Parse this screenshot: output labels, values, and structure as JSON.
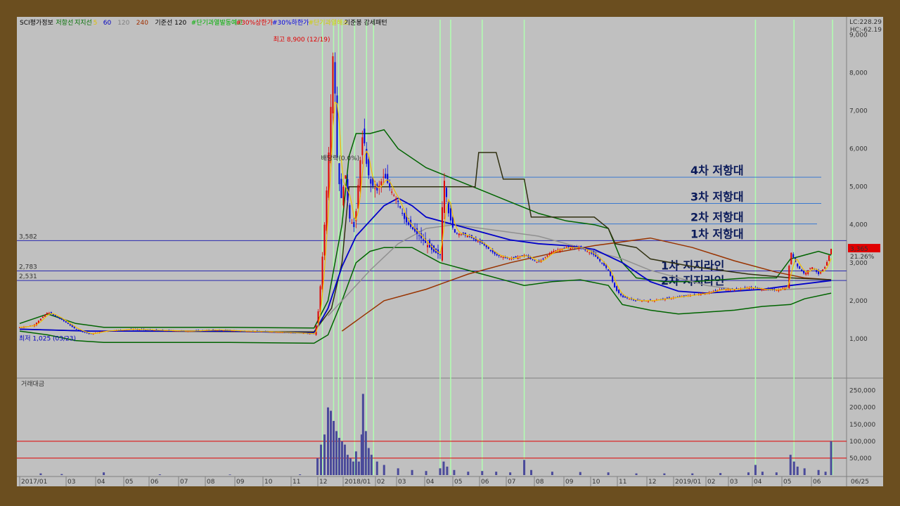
{
  "legend": [
    {
      "text": "SCI평가정보",
      "color": "#000000"
    },
    {
      "text": "저항선",
      "color": "#007000"
    },
    {
      "text": "지지선",
      "color": "#007000"
    },
    {
      "text": "5",
      "color": "#e0c000"
    },
    {
      "text": "60",
      "color": "#0000c0"
    },
    {
      "text": "120",
      "color": "#808080"
    },
    {
      "text": "240",
      "color": "#a03000"
    },
    {
      "text": "기준선 120",
      "color": "#000000"
    },
    {
      "text": "#단기과열발동예고",
      "color": "#00b000"
    },
    {
      "text": "#30%상한가",
      "color": "#e00000"
    },
    {
      "text": "#30%하한가",
      "color": "#0000e0"
    },
    {
      "text": "#단기과열해소",
      "color": "#d0d000"
    },
    {
      "text": "기준봉 강세패턴",
      "color": "#000000"
    }
  ],
  "lc_label": "LC:228.29",
  "hc_label": "HC:-62.19",
  "volume_title": "거래대금",
  "date_readout": "06/25",
  "annotations": {
    "high": "최고 8,900 (12/19)",
    "low": "최저 1,025 (03/23)",
    "badge": "배당락(0.0%)",
    "price_box": "3,365",
    "pct_box": "21.26%"
  },
  "colors": {
    "up": "#e00000",
    "down": "#0000e0",
    "band": "#006400",
    "ma5": "#f0c000",
    "ma60": "#0000c8",
    "ma120": "#909090",
    "ma240": "#993300",
    "base": "#303010",
    "vline": "#b0ffb0",
    "hline": "#2a2ab0",
    "resist": "#3a7ad0"
  },
  "chart_data": [
    {
      "type": "line",
      "title": "",
      "xlabel": "",
      "ylabel": "",
      "ylim": [
        0,
        9100
      ],
      "x_ticks": [
        "2017/01",
        "03",
        "04",
        "05",
        "06",
        "07",
        "08",
        "09",
        "10",
        "11",
        "12",
        "2018/01",
        "02",
        "03",
        "04",
        "05",
        "06",
        "07",
        "08",
        "09",
        "10",
        "11",
        "12",
        "2019/01",
        "02",
        "03",
        "04",
        "05",
        "06"
      ],
      "y_ticks": [
        "1,000",
        "2,000",
        "3,000",
        "4,000",
        "5,000",
        "6,000",
        "7,000",
        "8,000",
        "9,000"
      ],
      "series": [],
      "levels": [
        {
          "name": "4차 저항대",
          "value": 5250
        },
        {
          "name": "3차 저항대",
          "value": 4560
        },
        {
          "name": "2차 저항대",
          "value": 4020
        },
        {
          "name": "1차 저항대",
          "value": 3582
        },
        {
          "name": "1차 지지라인",
          "value": 2783
        },
        {
          "name": "2차 지지라인",
          "value": 2531
        }
      ],
      "level_labels": [
        "3,582",
        "2,783",
        "2,531"
      ],
      "current_price": 3365,
      "price_path": [
        [
          0,
          1300
        ],
        [
          20,
          1350
        ],
        [
          40,
          1700
        ],
        [
          60,
          1500
        ],
        [
          80,
          1250
        ],
        [
          100,
          1120
        ],
        [
          120,
          1200
        ],
        [
          160,
          1250
        ],
        [
          200,
          1220
        ],
        [
          240,
          1200
        ],
        [
          280,
          1230
        ],
        [
          320,
          1200
        ],
        [
          360,
          1180
        ],
        [
          400,
          1150
        ],
        [
          420,
          1130
        ],
        [
          425,
          1500
        ],
        [
          430,
          2600
        ],
        [
          435,
          4000
        ],
        [
          440,
          5500
        ],
        [
          445,
          7500
        ],
        [
          448,
          8900
        ],
        [
          452,
          6000
        ],
        [
          458,
          4600
        ],
        [
          465,
          5300
        ],
        [
          470,
          4200
        ],
        [
          478,
          3900
        ],
        [
          485,
          5500
        ],
        [
          490,
          6500
        ],
        [
          495,
          5600
        ],
        [
          500,
          5100
        ],
        [
          510,
          4900
        ],
        [
          520,
          5300
        ],
        [
          530,
          4900
        ],
        [
          540,
          4600
        ],
        [
          550,
          4100
        ],
        [
          570,
          3700
        ],
        [
          590,
          3300
        ],
        [
          600,
          3200
        ],
        [
          605,
          5300
        ],
        [
          612,
          4300
        ],
        [
          620,
          3800
        ],
        [
          640,
          3700
        ],
        [
          660,
          3500
        ],
        [
          680,
          3200
        ],
        [
          700,
          3100
        ],
        [
          720,
          3200
        ],
        [
          740,
          3000
        ],
        [
          760,
          3300
        ],
        [
          780,
          3400
        ],
        [
          800,
          3400
        ],
        [
          820,
          3200
        ],
        [
          840,
          2800
        ],
        [
          850,
          2300
        ],
        [
          860,
          2100
        ],
        [
          880,
          2000
        ],
        [
          900,
          2000
        ],
        [
          920,
          2050
        ],
        [
          940,
          2100
        ],
        [
          960,
          2150
        ],
        [
          980,
          2200
        ],
        [
          1000,
          2300
        ],
        [
          1020,
          2300
        ],
        [
          1040,
          2350
        ],
        [
          1060,
          2300
        ],
        [
          1080,
          2280
        ],
        [
          1095,
          2350
        ],
        [
          1100,
          3300
        ],
        [
          1105,
          3100
        ],
        [
          1110,
          2900
        ],
        [
          1120,
          2700
        ],
        [
          1130,
          2900
        ],
        [
          1140,
          2700
        ],
        [
          1150,
          2900
        ],
        [
          1158,
          3365
        ]
      ],
      "ma60_path": [
        [
          0,
          1250
        ],
        [
          100,
          1200
        ],
        [
          200,
          1200
        ],
        [
          300,
          1200
        ],
        [
          420,
          1150
        ],
        [
          440,
          1800
        ],
        [
          460,
          2900
        ],
        [
          480,
          3700
        ],
        [
          500,
          4100
        ],
        [
          520,
          4500
        ],
        [
          540,
          4700
        ],
        [
          560,
          4500
        ],
        [
          580,
          4200
        ],
        [
          620,
          4000
        ],
        [
          660,
          3800
        ],
        [
          700,
          3600
        ],
        [
          740,
          3500
        ],
        [
          780,
          3450
        ],
        [
          820,
          3350
        ],
        [
          860,
          3000
        ],
        [
          900,
          2500
        ],
        [
          940,
          2250
        ],
        [
          980,
          2200
        ],
        [
          1020,
          2250
        ],
        [
          1060,
          2300
        ],
        [
          1100,
          2400
        ],
        [
          1158,
          2530
        ]
      ],
      "ma120_path": [
        [
          440,
          1600
        ],
        [
          460,
          2000
        ],
        [
          500,
          2800
        ],
        [
          540,
          3500
        ],
        [
          580,
          3900
        ],
        [
          620,
          4000
        ],
        [
          660,
          3900
        ],
        [
          700,
          3800
        ],
        [
          740,
          3700
        ],
        [
          780,
          3500
        ],
        [
          820,
          3300
        ],
        [
          860,
          3100
        ],
        [
          900,
          2800
        ],
        [
          940,
          2600
        ],
        [
          980,
          2400
        ],
        [
          1020,
          2300
        ],
        [
          1060,
          2280
        ],
        [
          1100,
          2300
        ],
        [
          1158,
          2360
        ]
      ],
      "ma240_path": [
        [
          460,
          1200
        ],
        [
          520,
          2000
        ],
        [
          580,
          2300
        ],
        [
          640,
          2700
        ],
        [
          700,
          3000
        ],
        [
          760,
          3250
        ],
        [
          820,
          3450
        ],
        [
          880,
          3600
        ],
        [
          900,
          3650
        ],
        [
          960,
          3400
        ],
        [
          1020,
          3050
        ],
        [
          1080,
          2750
        ],
        [
          1120,
          2600
        ],
        [
          1158,
          2550
        ]
      ],
      "upper_band": [
        [
          0,
          1400
        ],
        [
          40,
          1650
        ],
        [
          80,
          1400
        ],
        [
          120,
          1300
        ],
        [
          200,
          1300
        ],
        [
          300,
          1300
        ],
        [
          420,
          1280
        ],
        [
          440,
          2000
        ],
        [
          460,
          4000
        ],
        [
          470,
          5800
        ],
        [
          480,
          6400
        ],
        [
          500,
          6400
        ],
        [
          520,
          6500
        ],
        [
          540,
          6000
        ],
        [
          580,
          5500
        ],
        [
          620,
          5200
        ],
        [
          660,
          4900
        ],
        [
          700,
          4600
        ],
        [
          740,
          4300
        ],
        [
          780,
          4100
        ],
        [
          820,
          4000
        ],
        [
          840,
          3900
        ],
        [
          860,
          3000
        ],
        [
          880,
          2600
        ],
        [
          920,
          2500
        ],
        [
          960,
          2500
        ],
        [
          1000,
          2550
        ],
        [
          1040,
          2600
        ],
        [
          1080,
          2600
        ],
        [
          1100,
          3100
        ],
        [
          1140,
          3300
        ],
        [
          1158,
          3200
        ]
      ],
      "lower_band": [
        [
          0,
          1200
        ],
        [
          40,
          1100
        ],
        [
          80,
          950
        ],
        [
          120,
          900
        ],
        [
          200,
          900
        ],
        [
          300,
          900
        ],
        [
          420,
          880
        ],
        [
          440,
          1100
        ],
        [
          460,
          2000
        ],
        [
          480,
          3000
        ],
        [
          500,
          3300
        ],
        [
          520,
          3400
        ],
        [
          560,
          3400
        ],
        [
          600,
          3000
        ],
        [
          620,
          2900
        ],
        [
          660,
          2700
        ],
        [
          700,
          2500
        ],
        [
          720,
          2400
        ],
        [
          760,
          2500
        ],
        [
          800,
          2550
        ],
        [
          840,
          2400
        ],
        [
          860,
          1900
        ],
        [
          900,
          1750
        ],
        [
          940,
          1650
        ],
        [
          980,
          1700
        ],
        [
          1020,
          1750
        ],
        [
          1060,
          1850
        ],
        [
          1100,
          1900
        ],
        [
          1120,
          2050
        ],
        [
          1158,
          2200
        ]
      ],
      "base_path": [
        [
          0,
          1250
        ],
        [
          100,
          1200
        ],
        [
          420,
          1180
        ],
        [
          445,
          1800
        ],
        [
          460,
          3000
        ],
        [
          470,
          5000
        ],
        [
          560,
          5000
        ],
        [
          600,
          5000
        ],
        [
          650,
          5000
        ],
        [
          655,
          5900
        ],
        [
          680,
          5900
        ],
        [
          690,
          5200
        ],
        [
          720,
          5200
        ],
        [
          730,
          4200
        ],
        [
          820,
          4200
        ],
        [
          840,
          3900
        ],
        [
          850,
          3500
        ],
        [
          880,
          3400
        ],
        [
          900,
          3100
        ],
        [
          960,
          2900
        ],
        [
          1040,
          2700
        ],
        [
          1100,
          2600
        ],
        [
          1158,
          2550
        ]
      ],
      "vlines": [
        432,
        448,
        455,
        460,
        478,
        495,
        505,
        600,
        615,
        660,
        720,
        1050,
        1105,
        1160
      ]
    },
    {
      "type": "bar",
      "title": "거래대금",
      "ylim": [
        0,
        270000
      ],
      "y_ticks": [
        "50,000",
        "100,000",
        "150,000",
        "200,000",
        "250,000"
      ],
      "ref_lines": [
        100000,
        50000
      ],
      "volumes": [
        [
          30,
          5000
        ],
        [
          60,
          3000
        ],
        [
          120,
          8000
        ],
        [
          200,
          2000
        ],
        [
          300,
          1500
        ],
        [
          400,
          2000
        ],
        [
          425,
          50000
        ],
        [
          430,
          90000
        ],
        [
          435,
          120000
        ],
        [
          440,
          200000
        ],
        [
          444,
          190000
        ],
        [
          448,
          160000
        ],
        [
          452,
          130000
        ],
        [
          456,
          110000
        ],
        [
          460,
          100000
        ],
        [
          464,
          90000
        ],
        [
          468,
          60000
        ],
        [
          472,
          50000
        ],
        [
          476,
          40000
        ],
        [
          480,
          70000
        ],
        [
          484,
          40000
        ],
        [
          488,
          120000
        ],
        [
          490,
          240000
        ],
        [
          494,
          130000
        ],
        [
          498,
          80000
        ],
        [
          502,
          60000
        ],
        [
          510,
          40000
        ],
        [
          520,
          30000
        ],
        [
          540,
          20000
        ],
        [
          560,
          15000
        ],
        [
          580,
          12000
        ],
        [
          600,
          20000
        ],
        [
          605,
          40000
        ],
        [
          610,
          25000
        ],
        [
          620,
          15000
        ],
        [
          640,
          10000
        ],
        [
          660,
          12000
        ],
        [
          680,
          10000
        ],
        [
          700,
          8000
        ],
        [
          720,
          45000
        ],
        [
          730,
          15000
        ],
        [
          760,
          10000
        ],
        [
          800,
          9000
        ],
        [
          840,
          8000
        ],
        [
          880,
          5000
        ],
        [
          920,
          5000
        ],
        [
          960,
          5000
        ],
        [
          1000,
          6000
        ],
        [
          1040,
          8000
        ],
        [
          1050,
          30000
        ],
        [
          1060,
          10000
        ],
        [
          1080,
          8000
        ],
        [
          1100,
          60000
        ],
        [
          1105,
          40000
        ],
        [
          1110,
          25000
        ],
        [
          1120,
          20000
        ],
        [
          1140,
          15000
        ],
        [
          1150,
          10000
        ],
        [
          1158,
          100000
        ]
      ]
    }
  ]
}
